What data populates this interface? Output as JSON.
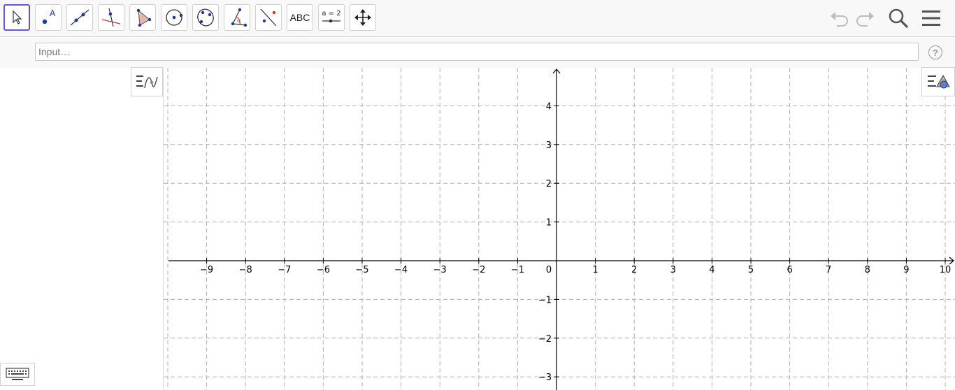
{
  "toolbar": {
    "tools": [
      {
        "name": "move-tool",
        "icon": "arrow-pointer-icon"
      },
      {
        "name": "point-tool",
        "icon": "point-icon",
        "label": "A"
      },
      {
        "name": "line-tool",
        "icon": "line-icon"
      },
      {
        "name": "perpendicular-line-tool",
        "icon": "perpendicular-icon"
      },
      {
        "name": "polygon-tool",
        "icon": "polygon-icon"
      },
      {
        "name": "circle-tool",
        "icon": "circle-icon"
      },
      {
        "name": "conic-tool",
        "icon": "ellipse-icon"
      },
      {
        "name": "angle-tool",
        "icon": "angle-icon",
        "label": "α"
      },
      {
        "name": "reflect-tool",
        "icon": "reflect-icon"
      },
      {
        "name": "text-tool",
        "icon": "text-icon",
        "label": "ABC"
      },
      {
        "name": "slider-tool",
        "icon": "slider-icon",
        "label": "a = 2"
      },
      {
        "name": "move-graphics-tool",
        "icon": "move-arrows-icon"
      }
    ],
    "right": [
      "undo-icon",
      "redo-icon",
      "search-icon",
      "menu-icon"
    ]
  },
  "input": {
    "placeholder": "Input…",
    "value": ""
  },
  "help": {
    "label": "?"
  },
  "graphics": {
    "x_ticks": [
      "−9",
      "−8",
      "−7",
      "−6",
      "−5",
      "−4",
      "−3",
      "−2",
      "−1",
      "1",
      "2",
      "3",
      "4",
      "5",
      "6",
      "7",
      "8",
      "9",
      "10"
    ],
    "y_ticks": [
      "4",
      "3",
      "2",
      "1",
      "−1",
      "−2",
      "−3"
    ],
    "origin_label": "0",
    "grid": true
  },
  "colors": {
    "accent": "#6557d2",
    "toolbar_bg": "#f8f8f8",
    "grid": "#b0b0b0",
    "point": "#1565c0"
  }
}
